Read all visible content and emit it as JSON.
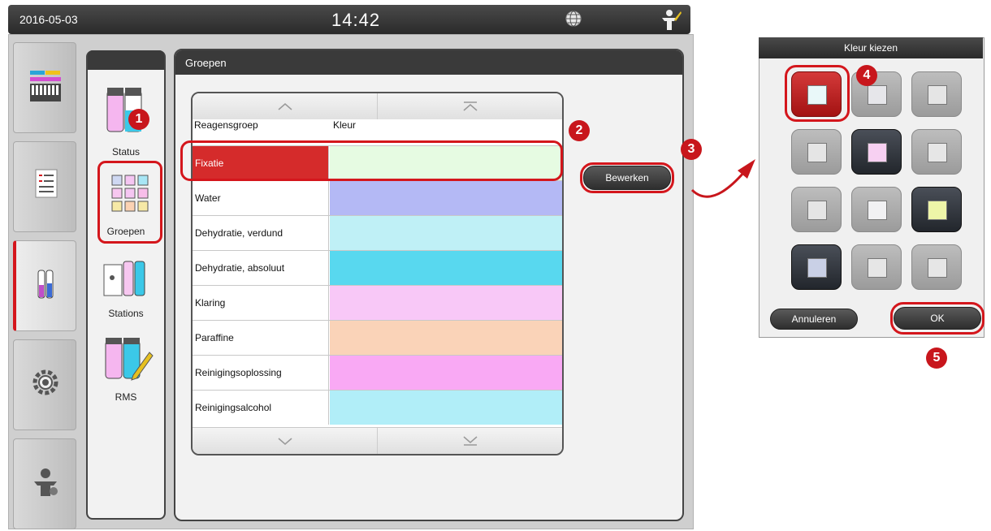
{
  "status_bar": {
    "date": "2016-05-03",
    "time": "14:42"
  },
  "nav": {
    "tabs": [
      "reagent-rack-icon",
      "program-list-icon",
      "reagent-bottles-icon",
      "gear-icon",
      "user-settings-icon"
    ],
    "active_index": 2
  },
  "submenu": {
    "items": [
      {
        "label": "Status"
      },
      {
        "label": "Groepen"
      },
      {
        "label": "Stations"
      },
      {
        "label": "RMS"
      }
    ],
    "selected": "Groepen"
  },
  "panel": {
    "title": "Groepen",
    "table": {
      "headers": [
        "Reagensgroep",
        "Kleur"
      ],
      "rows": [
        {
          "name": "Fixatie",
          "color": "#e6fbe2"
        },
        {
          "name": "Water",
          "color": "#b4b9f5"
        },
        {
          "name": "Dehydratie, verdund",
          "color": "#bff0f6"
        },
        {
          "name": "Dehydratie, absoluut",
          "color": "#58d8ef"
        },
        {
          "name": "Klaring",
          "color": "#f8c8f7"
        },
        {
          "name": "Paraffine",
          "color": "#fad3b8"
        },
        {
          "name": "Reinigingsoplossing",
          "color": "#f9a9f4"
        },
        {
          "name": "Reinigingsalcohol",
          "color": "#b1eef8"
        }
      ],
      "selected_row": 0,
      "selected_color": "#d52b2b"
    },
    "edit_button": "Bewerken"
  },
  "color_dialog": {
    "title": "Kleur kiezen",
    "cancel_label": "Annuleren",
    "ok_label": "OK",
    "swatches": [
      "#e9f8f9",
      "#e6e6ea",
      "#e5e5e5",
      "#e5e5e5",
      "#f7d0f2",
      "#e6e6e6",
      "#e5e5e5",
      "#f1f1f3",
      "#eef5a8",
      "#c9d0e6",
      "#e6e6e6",
      "#e6e6e6"
    ]
  },
  "callouts": [
    "1",
    "2",
    "3",
    "4",
    "5"
  ],
  "accent_red": "#c8161c"
}
